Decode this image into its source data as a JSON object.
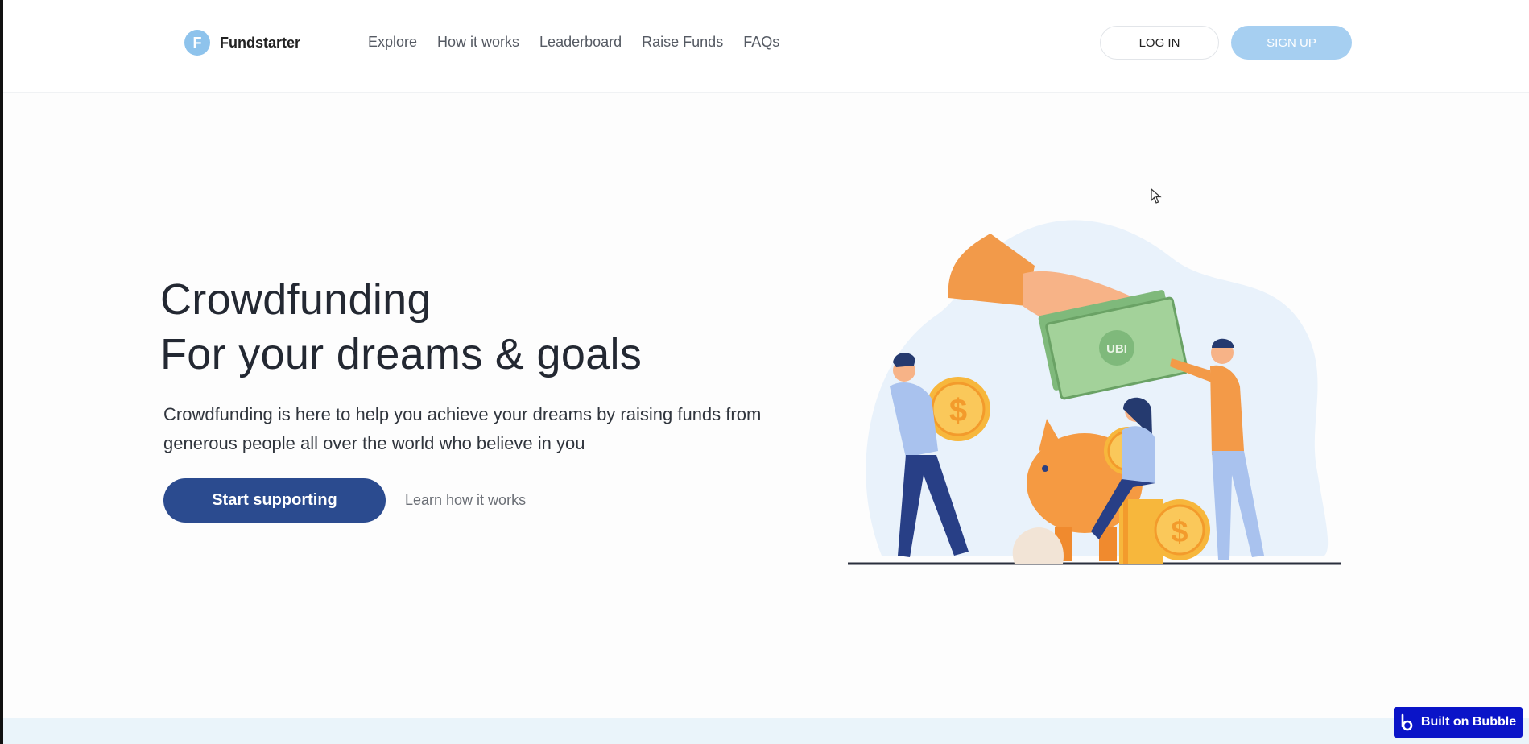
{
  "header": {
    "logo_letter": "F",
    "brand": "Fundstarter",
    "nav": [
      "Explore",
      "How it works",
      "Leaderboard",
      "Raise Funds",
      "FAQs"
    ],
    "login_label": "LOG IN",
    "signup_label": "SIGN UP"
  },
  "hero": {
    "title_line1": "Crowdfunding",
    "title_line2": "For your dreams & goals",
    "subtitle": "Crowdfunding is here to help you achieve your dreams by raising funds from generous people all over the world who believe in you",
    "cta_primary": "Start supporting",
    "cta_secondary": "Learn how it works",
    "illustration_icon": "piggy-bank-illustration",
    "banknote_text": "UBI",
    "coin_symbol": "$"
  },
  "badge": {
    "label": "Built on Bubble",
    "icon": "bubble-logo-icon"
  },
  "colors": {
    "primary": "#2b4b8f",
    "signup": "#a6cff1",
    "logo": "#8ec3ec",
    "badge": "#0a14c8"
  }
}
